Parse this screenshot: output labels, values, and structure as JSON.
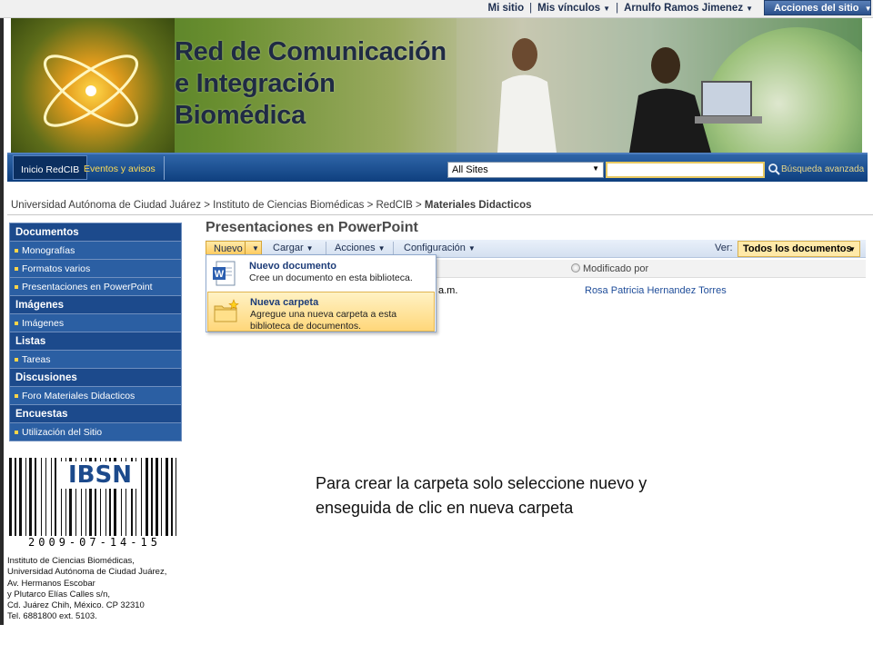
{
  "topbar": {
    "my_site": "Mi sitio",
    "separator": "|",
    "my_links": "Mis vínculos",
    "user": "Arnulfo Ramos Jimenez",
    "site_actions": "Acciones del sitio"
  },
  "banner": {
    "title_line1": "Red de Comunicación",
    "title_line2": "e Integración",
    "title_line3": "Biomédica"
  },
  "nav": {
    "home": "Inicio RedCIB",
    "events": "Eventos y avisos",
    "scope": "All Sites",
    "search_value": "",
    "advanced_search": "Búsqueda avanzada"
  },
  "breadcrumb": {
    "items": [
      "Universidad Autónoma de Ciudad Juárez",
      "Instituto de Ciencias Biomédicas",
      "RedCIB"
    ],
    "separator": ">",
    "current": "Materiales Didacticos"
  },
  "quicklaunch": {
    "sections": [
      {
        "header": "Documentos",
        "items": [
          "Monografías",
          "Formatos varios",
          "Presentaciones en PowerPoint"
        ]
      },
      {
        "header": "Imágenes",
        "items": [
          "Imágenes"
        ]
      },
      {
        "header": "Listas",
        "items": [
          "Tareas"
        ]
      },
      {
        "header": "Discusiones",
        "items": [
          "Foro Materiales Didacticos"
        ]
      },
      {
        "header": "Encuestas",
        "items": [
          "Utilización del Sitio"
        ]
      }
    ]
  },
  "ibsn": {
    "label": "IBSN",
    "number": "2009-07-14-15"
  },
  "address": {
    "lines": [
      "Instituto de Ciencias Biomédicas,",
      "Universidad Autónoma de Ciudad Juárez,",
      "Av. Hermanos Escobar",
      "y Plutarco Elías Calles s/n,",
      "Cd. Juárez Chih, México. CP 32310",
      "Tel. 6881800 ext. 5103."
    ]
  },
  "main": {
    "title": "Presentaciones en PowerPoint",
    "toolbar": {
      "new": "Nuevo",
      "upload": "Cargar",
      "actions": "Acciones",
      "settings": "Configuración",
      "view_label": "Ver:",
      "view_value": "Todos los documentos"
    },
    "columns": {
      "modified_by": "Modificado por"
    },
    "row": {
      "time_suffix": "a.m.",
      "user": "Rosa Patricia Hernandez Torres"
    },
    "menu": {
      "items": [
        {
          "title": "Nuevo documento",
          "desc": "Cree un documento en esta biblioteca."
        },
        {
          "title": "Nueva carpeta",
          "desc": "Agregue una nueva carpeta a esta biblioteca de documentos."
        }
      ]
    }
  },
  "note": {
    "line1": "Para crear la carpeta solo seleccione nuevo y",
    "line2": "enseguida de clic en nueva carpeta"
  },
  "colors": {
    "nav_blue": "#1c4a8c",
    "accent_yellow": "#ffd44a",
    "link_blue": "#1f4d9a"
  }
}
